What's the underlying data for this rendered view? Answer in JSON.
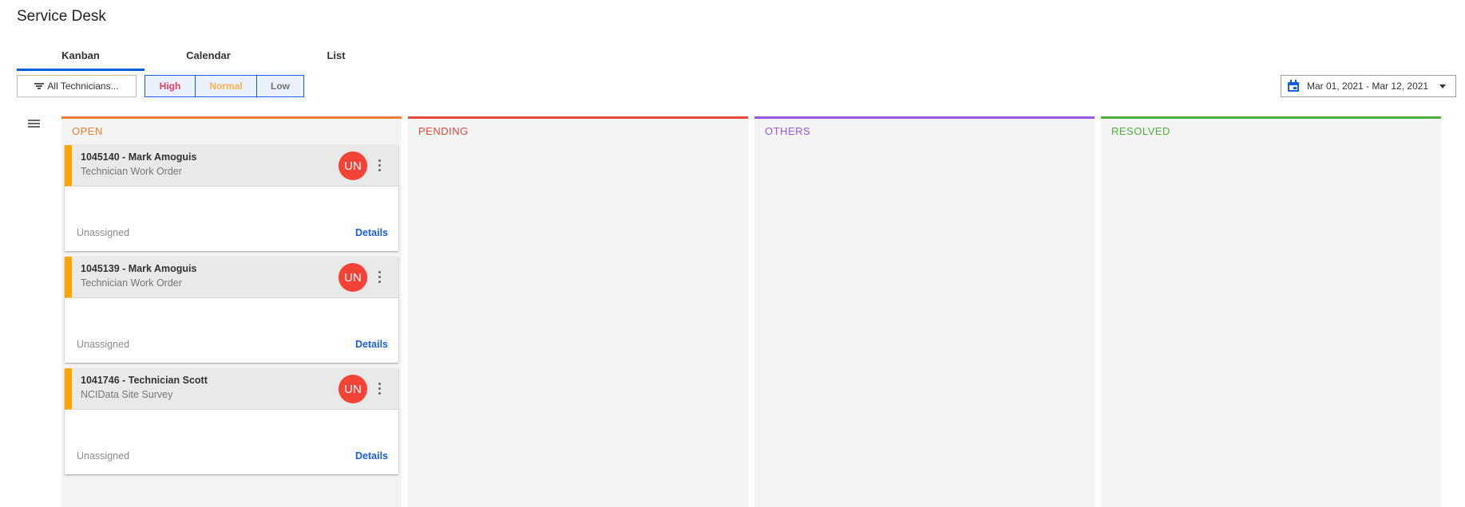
{
  "header": {
    "title": "Service Desk"
  },
  "tabs": [
    {
      "label": "Kanban",
      "active": true
    },
    {
      "label": "Calendar",
      "active": false
    },
    {
      "label": "List",
      "active": false
    }
  ],
  "toolbar": {
    "technicians_filter": {
      "label": "All Technicians...",
      "icon": "filter-icon"
    },
    "priority_filters": [
      {
        "label": "High",
        "color": "#e63b5c"
      },
      {
        "label": "Normal",
        "color": "#f9b04c"
      },
      {
        "label": "Low",
        "color": "#757575"
      }
    ],
    "date_range": {
      "label": "Mar 01, 2021 - Mar 12, 2021",
      "icon": "calendar-icon"
    }
  },
  "board": {
    "columns": [
      {
        "title": "OPEN",
        "color": "#ef7d31",
        "cards": [
          {
            "title": "1045140 - Mark Amoguis",
            "subtitle": "Technician Work Order",
            "avatar": "UN",
            "assignee": "Unassigned",
            "action": "Details",
            "priority_color": "#ffa500"
          },
          {
            "title": "1045139 - Mark Amoguis",
            "subtitle": "Technician Work Order",
            "avatar": "UN",
            "assignee": "Unassigned",
            "action": "Details",
            "priority_color": "#ffa500"
          },
          {
            "title": "1041746 - Technician Scott",
            "subtitle": "NCIData Site Survey",
            "avatar": "UN",
            "assignee": "Unassigned",
            "action": "Details",
            "priority_color": "#ffa500"
          }
        ]
      },
      {
        "title": "PENDING",
        "color": "#e8453c",
        "cards": []
      },
      {
        "title": "OTHERS",
        "color": "#9c56e8",
        "cards": []
      },
      {
        "title": "RESOLVED",
        "color": "#4caf3a",
        "cards": []
      }
    ]
  }
}
